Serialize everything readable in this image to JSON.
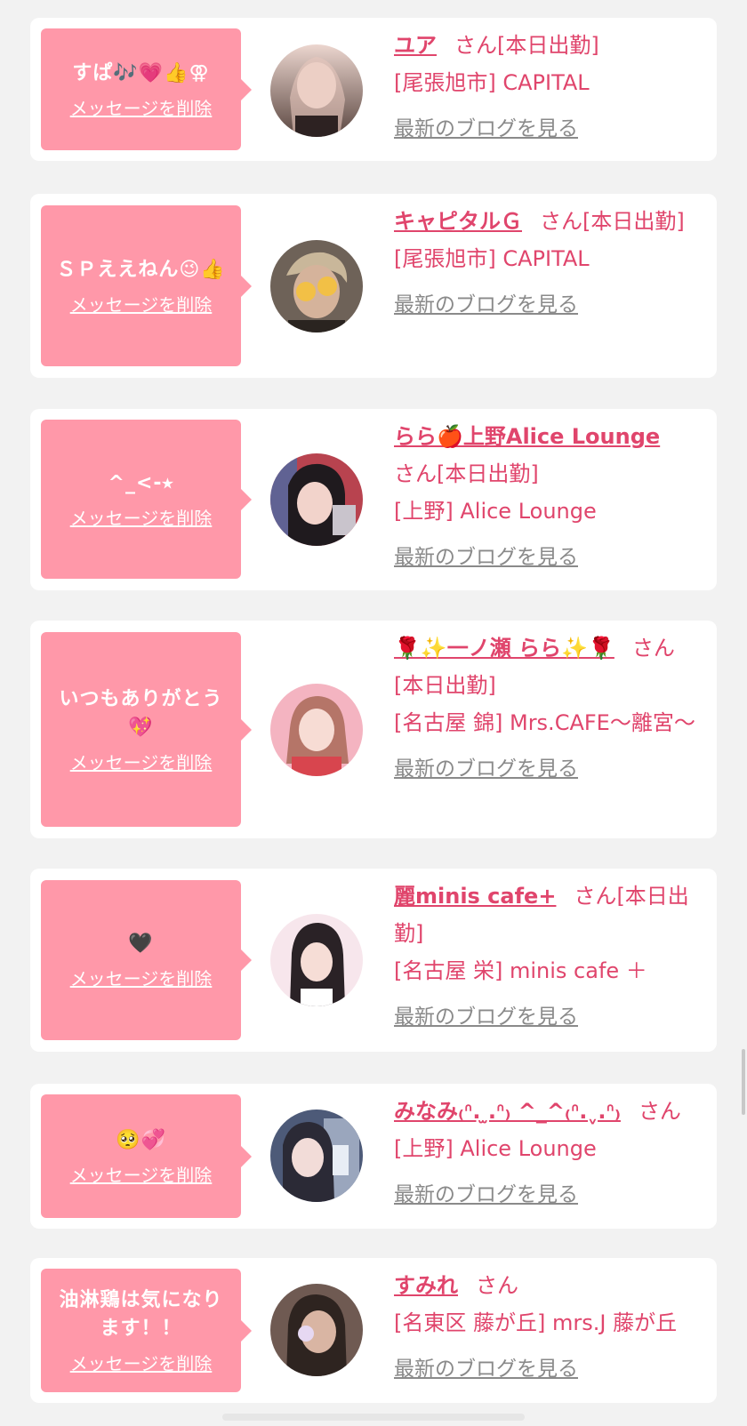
{
  "items": [
    {
      "message": "すぱ🎶💗👍⚢",
      "delete_label": "メッセージを削除",
      "name": "ユア",
      "honorific": "さん",
      "status": "[本日出勤]",
      "shop": "[尾張旭市] CAPITAL",
      "blog_link": "最新のブログを見る",
      "avatar_colors": [
        "#e9d2cb",
        "#c9a89c"
      ]
    },
    {
      "message": "ＳＰええねん😉👍",
      "delete_label": "メッセージを削除",
      "name": "キャピタルＧ",
      "honorific": "さん",
      "status": "[本日出勤]",
      "shop": "[尾張旭市] CAPITAL",
      "blog_link": "最新のブログを見る",
      "avatar_colors": [
        "#8a7b6e",
        "#4b4038"
      ]
    },
    {
      "message": "^_<-⭑",
      "delete_label": "メッセージを削除",
      "name": "らら🍎上野Alice Lounge",
      "honorific": "さん",
      "status": "[本日出勤]",
      "shop": "[上野] Alice Lounge",
      "blog_link": "最新のブログを見る",
      "avatar_colors": [
        "#c24a5a",
        "#2a2530"
      ]
    },
    {
      "message": "いつもありがとう💖",
      "delete_label": "メッセージを削除",
      "name": "🌹✨一ノ瀬 らら✨🌹",
      "honorific": "さん",
      "status": "[本日出勤]",
      "shop": "[名古屋 錦] Mrs.CAFE〜離宮〜",
      "blog_link": "最新のブログを見る",
      "avatar_colors": [
        "#f3b9c4",
        "#d98a94"
      ]
    },
    {
      "message": "🖤",
      "delete_label": "メッセージを削除",
      "name": "麗minis cafe+",
      "honorific": "さん",
      "status": "[本日出勤]",
      "shop": "[名古屋 栄] minis cafe ＋",
      "blog_link": "最新のブログを見る",
      "avatar_colors": [
        "#f6e3ea",
        "#2b2327"
      ]
    },
    {
      "message": "🥺💞",
      "delete_label": "メッセージを削除",
      "name": "みなみ₍ᐢ. ̫.ᐢ₎ ^_^₍ᐢ.ˬ.ᐢ₎",
      "honorific": "さん",
      "status": "",
      "shop": "[上野] Alice Lounge",
      "blog_link": "最新のブログを見る",
      "avatar_colors": [
        "#5d6e8f",
        "#2e3550"
      ]
    },
    {
      "message": "油淋鶏は気になります！！",
      "delete_label": "メッセージを削除",
      "name": "すみれ",
      "honorific": "さん",
      "status": "",
      "shop": "[名東区 藤が丘] mrs.J 藤が丘",
      "blog_link": "最新のブログを見る",
      "avatar_colors": [
        "#9a7d6e",
        "#3a2e2a"
      ]
    }
  ]
}
